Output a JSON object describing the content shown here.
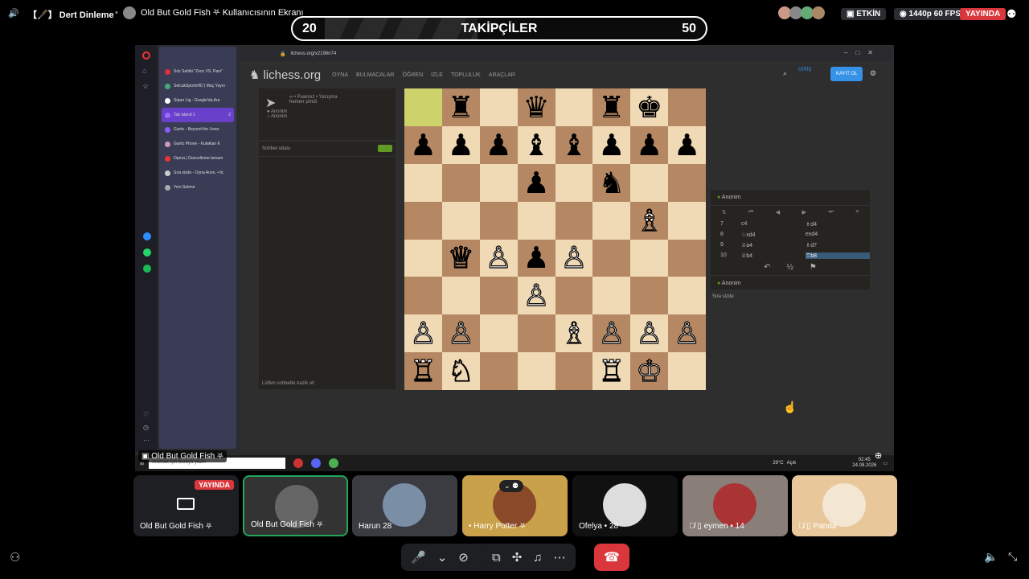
{
  "top_bar": {
    "channel": "【🖋️】 Dert Dinleme",
    "screen_title": "Old But Gold Fish ⛧ Kullanıcısının Ekranı",
    "activity_label": "ETKİN",
    "quality_label": "1440p 60 FPS",
    "live_label": "YAYINDA"
  },
  "banner": {
    "left_count": "20",
    "label": "TAKİPÇİLER",
    "right_count": "50"
  },
  "browser": {
    "url": "lichess.org/x2196n74",
    "tabs": [
      {
        "label": "Söz Sahibi \"Zeco VS. Pars\"",
        "color": "#d33"
      },
      {
        "label": "SelcukSportsHD | Maç Yayın",
        "color": "#4a7"
      },
      {
        "label": "Süper Lig - Google'da Ara",
        "color": "#fff"
      },
      {
        "label": "Tab island 1",
        "color": "#9b6bff",
        "badge": "2"
      },
      {
        "label": "Gartic - Beyond the Lines",
        "color": "#8a5cf6"
      },
      {
        "label": "Gartic Phone - Kulaktan K",
        "color": "#c9b"
      },
      {
        "label": "Opera | Güncelleme tamam",
        "color": "#e33"
      },
      {
        "label": "Sıra sizde - Oyna Anon. • lic",
        "color": "#ccc"
      },
      {
        "label": "Yeni Sekme",
        "color": "#aaa"
      }
    ]
  },
  "lichess": {
    "logo": "lichess.org",
    "nav": [
      "OYNA",
      "BULMACALAR",
      "ÖĞREN",
      "İZLE",
      "TOPLULUK",
      "ARAÇLAR"
    ],
    "login": "GİRİŞ",
    "signup": "KAYIT OL",
    "game_mode": "∞ • Puansız • Yazışma",
    "game_time": "hemen şimdi",
    "player1": "Anonim",
    "player2": "Anonim",
    "chat_room": "Sohbet odası",
    "chat_placeholder": "Lütfen sohbette nazik ol!",
    "opponent": "Anonim",
    "self": "Anonim",
    "turn": "Sıra sizde",
    "moves": [
      {
        "n": "7",
        "w": "c4",
        "b": "♗d4"
      },
      {
        "n": "8",
        "w": "♘xd4",
        "b": "exd4"
      },
      {
        "n": "9",
        "w": "♕a4",
        "b": "♗d7"
      },
      {
        "n": "10",
        "w": "♕b4",
        "b": "♖b8"
      }
    ],
    "board": [
      [
        "",
        "bR",
        "",
        "bQ",
        "",
        "bR",
        "bK",
        ""
      ],
      [
        "bP",
        "bP",
        "bP",
        "bB",
        "bB",
        "bP",
        "bP",
        "bP"
      ],
      [
        "",
        "",
        "",
        "bP",
        "",
        "bN",
        "",
        ""
      ],
      [
        "",
        "",
        "",
        "",
        "",
        "",
        "wB",
        ""
      ],
      [
        "",
        "wQ",
        "wP",
        "bP",
        "wP",
        "",
        "",
        ""
      ],
      [
        "",
        "",
        "",
        "wP",
        "",
        "",
        "",
        ""
      ],
      [
        "wP",
        "wP",
        "",
        "",
        "wB",
        "wP",
        "wP",
        "wP"
      ],
      [
        "wR",
        "wN",
        "",
        "",
        "",
        "wR",
        "wK",
        ""
      ]
    ],
    "highlight": "a8"
  },
  "taskbar": {
    "search": "Aramak için buraya yazın",
    "weather": "29°C",
    "weather_label": "Açık",
    "time": "02:45",
    "date": "24.08.2026"
  },
  "stream_label": "Old But Gold Fish ⛧",
  "participants": [
    {
      "name": "Old But Gold Fish ⛧",
      "badge": "YAYINDA"
    },
    {
      "name": "Old But Gold Fish ⛧"
    },
    {
      "name": "Harun 28"
    },
    {
      "name": "• Harry Potter ⛧"
    },
    {
      "name": "Ofelya • 28"
    },
    {
      "name": "eymen • 14"
    },
    {
      "name": "Panda"
    }
  ]
}
